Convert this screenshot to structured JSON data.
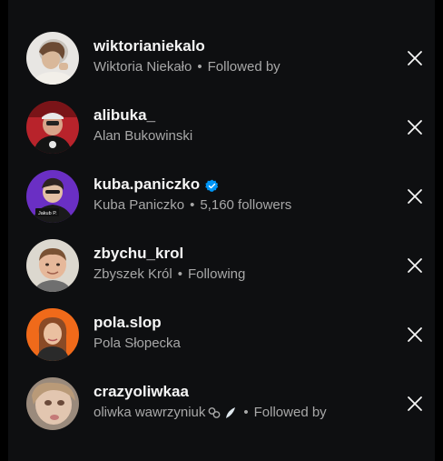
{
  "followers": [
    {
      "username": "wiktorianiekalo",
      "full_name": "Wiktoria Niekało",
      "separator": "•",
      "status": "Followed by",
      "verified": false
    },
    {
      "username": "alibuka_",
      "full_name": "Alan Bukowinski",
      "separator": "",
      "status": "",
      "verified": false
    },
    {
      "username": "kuba.paniczko",
      "full_name": "Kuba Paniczko",
      "separator": "•",
      "status": "5,160 followers",
      "verified": true,
      "avatar_label": "Jakub P."
    },
    {
      "username": "zbychu_krol",
      "full_name": "Zbyszek Król",
      "separator": "•",
      "status": "Following",
      "verified": false
    },
    {
      "username": "pola.slop",
      "full_name": "Pola Słopecka",
      "separator": "",
      "status": "",
      "verified": false
    },
    {
      "username": "crazyoliwkaa",
      "full_name": "oliwka wawrzyniuk",
      "separator": "•",
      "status": "Followed by",
      "verified": false
    }
  ],
  "colors": {
    "background": "#0e0f11",
    "primary_text": "#f5f5f5",
    "secondary_text": "#a8a8a8",
    "verified_badge": "#0095f6"
  },
  "icons": {
    "remove": "close-icon",
    "verified": "verified-badge-icon"
  }
}
